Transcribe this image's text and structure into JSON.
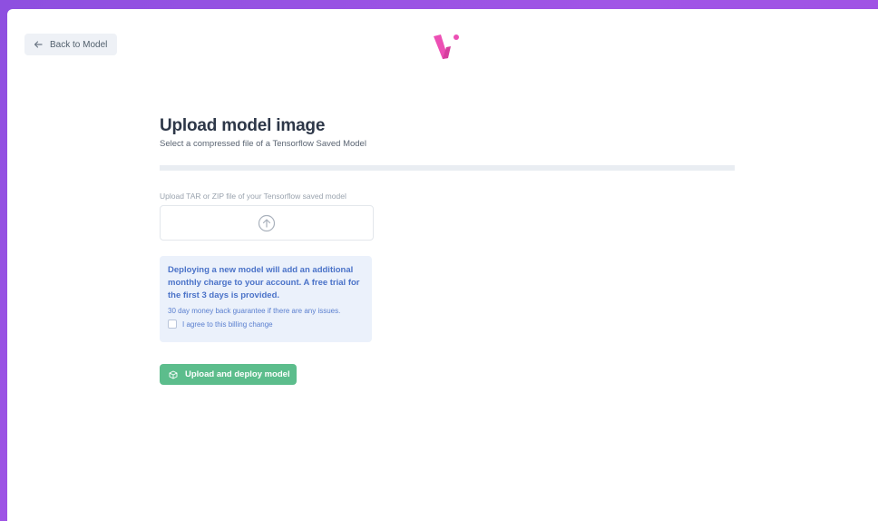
{
  "nav": {
    "back_label": "Back to Model"
  },
  "brand": {
    "logo_icon": "v-logo-icon",
    "accent": "#ec4fb4"
  },
  "page": {
    "title": "Upload model image",
    "subtitle": "Select a compressed file of a Tensorflow Saved Model"
  },
  "upload": {
    "label": "Upload TAR or ZIP file of your Tensorflow saved model",
    "icon": "upload-arrow-icon"
  },
  "notice": {
    "main": "Deploying a new model will add an additional monthly charge to your account. A free trial for the first 3 days is provided.",
    "sub": "30 day money back guarantee if there are any issues.",
    "agree_label": "I agree to this billing change",
    "agreed": false
  },
  "actions": {
    "deploy_label": "Upload and deploy model",
    "deploy_icon": "cube-icon",
    "deploy_color": "#5cbd8c"
  }
}
